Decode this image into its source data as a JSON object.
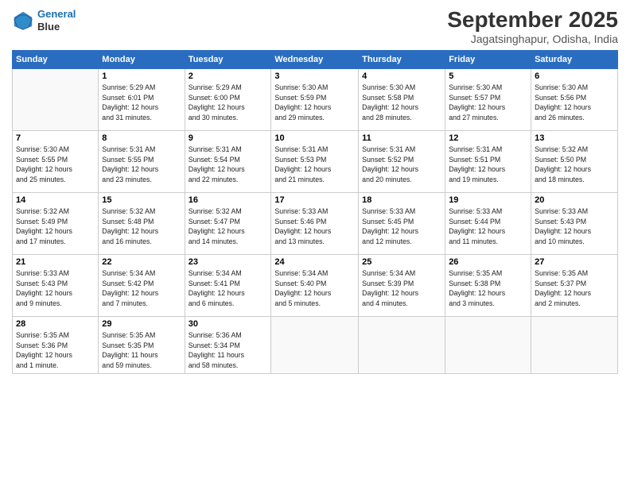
{
  "header": {
    "logo_line1": "General",
    "logo_line2": "Blue",
    "month_title": "September 2025",
    "subtitle": "Jagatsinghapur, Odisha, India"
  },
  "days_of_week": [
    "Sunday",
    "Monday",
    "Tuesday",
    "Wednesday",
    "Thursday",
    "Friday",
    "Saturday"
  ],
  "weeks": [
    [
      {
        "day": "",
        "info": ""
      },
      {
        "day": "1",
        "info": "Sunrise: 5:29 AM\nSunset: 6:01 PM\nDaylight: 12 hours\nand 31 minutes."
      },
      {
        "day": "2",
        "info": "Sunrise: 5:29 AM\nSunset: 6:00 PM\nDaylight: 12 hours\nand 30 minutes."
      },
      {
        "day": "3",
        "info": "Sunrise: 5:30 AM\nSunset: 5:59 PM\nDaylight: 12 hours\nand 29 minutes."
      },
      {
        "day": "4",
        "info": "Sunrise: 5:30 AM\nSunset: 5:58 PM\nDaylight: 12 hours\nand 28 minutes."
      },
      {
        "day": "5",
        "info": "Sunrise: 5:30 AM\nSunset: 5:57 PM\nDaylight: 12 hours\nand 27 minutes."
      },
      {
        "day": "6",
        "info": "Sunrise: 5:30 AM\nSunset: 5:56 PM\nDaylight: 12 hours\nand 26 minutes."
      }
    ],
    [
      {
        "day": "7",
        "info": "Sunrise: 5:30 AM\nSunset: 5:55 PM\nDaylight: 12 hours\nand 25 minutes."
      },
      {
        "day": "8",
        "info": "Sunrise: 5:31 AM\nSunset: 5:55 PM\nDaylight: 12 hours\nand 23 minutes."
      },
      {
        "day": "9",
        "info": "Sunrise: 5:31 AM\nSunset: 5:54 PM\nDaylight: 12 hours\nand 22 minutes."
      },
      {
        "day": "10",
        "info": "Sunrise: 5:31 AM\nSunset: 5:53 PM\nDaylight: 12 hours\nand 21 minutes."
      },
      {
        "day": "11",
        "info": "Sunrise: 5:31 AM\nSunset: 5:52 PM\nDaylight: 12 hours\nand 20 minutes."
      },
      {
        "day": "12",
        "info": "Sunrise: 5:31 AM\nSunset: 5:51 PM\nDaylight: 12 hours\nand 19 minutes."
      },
      {
        "day": "13",
        "info": "Sunrise: 5:32 AM\nSunset: 5:50 PM\nDaylight: 12 hours\nand 18 minutes."
      }
    ],
    [
      {
        "day": "14",
        "info": "Sunrise: 5:32 AM\nSunset: 5:49 PM\nDaylight: 12 hours\nand 17 minutes."
      },
      {
        "day": "15",
        "info": "Sunrise: 5:32 AM\nSunset: 5:48 PM\nDaylight: 12 hours\nand 16 minutes."
      },
      {
        "day": "16",
        "info": "Sunrise: 5:32 AM\nSunset: 5:47 PM\nDaylight: 12 hours\nand 14 minutes."
      },
      {
        "day": "17",
        "info": "Sunrise: 5:33 AM\nSunset: 5:46 PM\nDaylight: 12 hours\nand 13 minutes."
      },
      {
        "day": "18",
        "info": "Sunrise: 5:33 AM\nSunset: 5:45 PM\nDaylight: 12 hours\nand 12 minutes."
      },
      {
        "day": "19",
        "info": "Sunrise: 5:33 AM\nSunset: 5:44 PM\nDaylight: 12 hours\nand 11 minutes."
      },
      {
        "day": "20",
        "info": "Sunrise: 5:33 AM\nSunset: 5:43 PM\nDaylight: 12 hours\nand 10 minutes."
      }
    ],
    [
      {
        "day": "21",
        "info": "Sunrise: 5:33 AM\nSunset: 5:43 PM\nDaylight: 12 hours\nand 9 minutes."
      },
      {
        "day": "22",
        "info": "Sunrise: 5:34 AM\nSunset: 5:42 PM\nDaylight: 12 hours\nand 7 minutes."
      },
      {
        "day": "23",
        "info": "Sunrise: 5:34 AM\nSunset: 5:41 PM\nDaylight: 12 hours\nand 6 minutes."
      },
      {
        "day": "24",
        "info": "Sunrise: 5:34 AM\nSunset: 5:40 PM\nDaylight: 12 hours\nand 5 minutes."
      },
      {
        "day": "25",
        "info": "Sunrise: 5:34 AM\nSunset: 5:39 PM\nDaylight: 12 hours\nand 4 minutes."
      },
      {
        "day": "26",
        "info": "Sunrise: 5:35 AM\nSunset: 5:38 PM\nDaylight: 12 hours\nand 3 minutes."
      },
      {
        "day": "27",
        "info": "Sunrise: 5:35 AM\nSunset: 5:37 PM\nDaylight: 12 hours\nand 2 minutes."
      }
    ],
    [
      {
        "day": "28",
        "info": "Sunrise: 5:35 AM\nSunset: 5:36 PM\nDaylight: 12 hours\nand 1 minute."
      },
      {
        "day": "29",
        "info": "Sunrise: 5:35 AM\nSunset: 5:35 PM\nDaylight: 11 hours\nand 59 minutes."
      },
      {
        "day": "30",
        "info": "Sunrise: 5:36 AM\nSunset: 5:34 PM\nDaylight: 11 hours\nand 58 minutes."
      },
      {
        "day": "",
        "info": ""
      },
      {
        "day": "",
        "info": ""
      },
      {
        "day": "",
        "info": ""
      },
      {
        "day": "",
        "info": ""
      }
    ]
  ]
}
